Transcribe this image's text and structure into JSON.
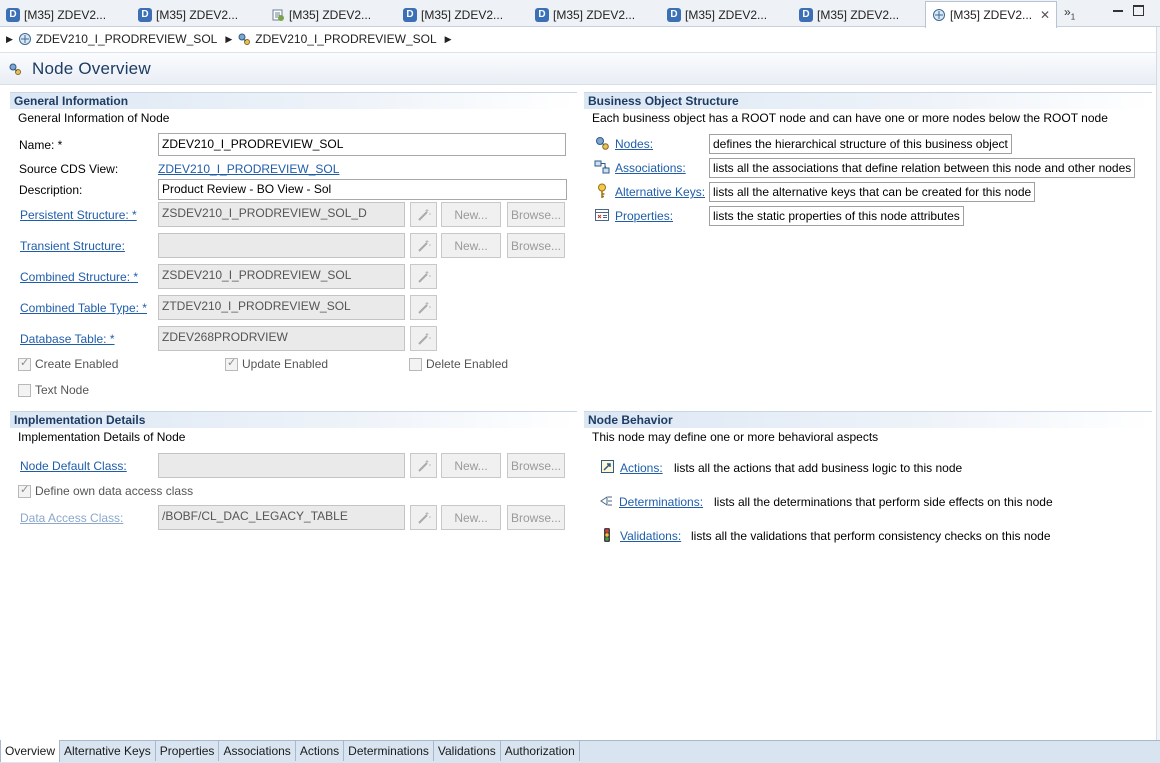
{
  "editor_tabs": [
    {
      "label": "[M35] ZDEV2...",
      "icon": "d-icon"
    },
    {
      "label": "[M35] ZDEV2...",
      "icon": "d-icon"
    },
    {
      "label": "[M35] ZDEV2...",
      "icon": "cds-icon"
    },
    {
      "label": "[M35] ZDEV2...",
      "icon": "d-icon"
    },
    {
      "label": "[M35] ZDEV2...",
      "icon": "d-icon"
    },
    {
      "label": "[M35] ZDEV2...",
      "icon": "d-icon"
    },
    {
      "label": "[M35] ZDEV2...",
      "icon": "d-icon"
    },
    {
      "label": "[M35] ZDEV2...",
      "icon": "bo-node-icon",
      "active": true
    }
  ],
  "overflow": {
    "label": "»",
    "count": "1"
  },
  "breadcrumb": [
    {
      "label": "ZDEV210_I_PRODREVIEW_SOL"
    },
    {
      "label": "ZDEV210_I_PRODREVIEW_SOL"
    }
  ],
  "page": {
    "title": "Node Overview"
  },
  "general": {
    "heading": "General Information",
    "description": "General Information of Node",
    "name_label": "Name: *",
    "name_value": "ZDEV210_I_PRODREVIEW_SOL",
    "cds_label": "Source CDS View:",
    "cds_value": "ZDEV210_I_PRODREVIEW_SOL",
    "desc_label": "Description:",
    "desc_value": "Product Review - BO View - Sol",
    "persistent_label": "Persistent Structure: *",
    "persistent_value": "ZSDEV210_I_PRODREVIEW_SOL_D",
    "transient_label": "Transient Structure:",
    "transient_value": "",
    "combined_label": "Combined Structure: *",
    "combined_value": "ZSDEV210_I_PRODREVIEW_SOL",
    "tabletype_label": "Combined Table Type: *",
    "tabletype_value": "ZTDEV210_I_PRODREVIEW_SOL",
    "dbtable_label": "Database Table: *",
    "dbtable_value": "ZDEV268PRODRVIEW",
    "new_label": "New...",
    "browse_label": "Browse...",
    "create_enabled": "Create Enabled",
    "update_enabled": "Update Enabled",
    "delete_enabled": "Delete Enabled",
    "text_node": "Text Node"
  },
  "structure": {
    "heading": "Business Object Structure",
    "description": "Each business object has a ROOT node and can have one or more nodes below the ROOT node",
    "items": [
      {
        "link": "Nodes:",
        "text": "defines the hierarchical structure of this business object"
      },
      {
        "link": "Associations:",
        "text": "lists all the associations that define relation between this node and other nodes"
      },
      {
        "link": "Alternative Keys:",
        "text": "lists all the alternative keys that can be created for this node"
      },
      {
        "link": "Properties:",
        "text": "lists the static properties of this node attributes"
      }
    ]
  },
  "implementation": {
    "heading": "Implementation Details",
    "description": "Implementation Details of Node",
    "default_class_label": "Node Default Class:",
    "default_class_value": "",
    "own_access_label": "Define own data access class",
    "access_class_label": "Data Access Class:",
    "access_class_value": "/BOBF/CL_DAC_LEGACY_TABLE",
    "new_label": "New...",
    "browse_label": "Browse..."
  },
  "behavior": {
    "heading": "Node Behavior",
    "description": "This node may define one or more behavioral aspects",
    "items": [
      {
        "link": "Actions:",
        "text": "lists all the actions that add business logic to this node"
      },
      {
        "link": "Determinations:",
        "text": "lists all the determinations that perform side effects on this node"
      },
      {
        "link": "Validations:",
        "text": "lists all the validations that perform consistency checks on this node"
      }
    ]
  },
  "bottom_tabs": [
    {
      "label": "Overview",
      "active": true
    },
    {
      "label": "Alternative Keys"
    },
    {
      "label": "Properties"
    },
    {
      "label": "Associations"
    },
    {
      "label": "Actions"
    },
    {
      "label": "Determinations"
    },
    {
      "label": "Validations"
    },
    {
      "label": "Authorization"
    }
  ],
  "colors": {
    "accent": "#1d3c63",
    "link": "#1f5dab",
    "tab_bg": "#d9e4f1"
  }
}
